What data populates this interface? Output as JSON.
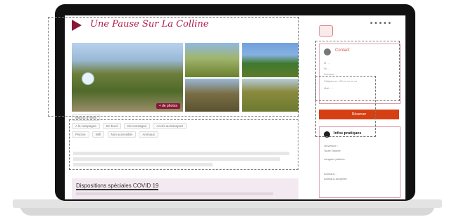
{
  "site": {
    "title": "Une Pause Sur La Colline",
    "photos_button": "+ de photos"
  },
  "sidebar": {
    "social_icons": [
      "twitter-icon",
      "facebook-icon",
      "instagram-icon",
      "email-icon",
      "phone-icon"
    ],
    "contact": {
      "title": "Contact",
      "lines": [
        "M. ...",
        "06 ...",
        "Adresse ...",
        "Téléphone : 06 xx xx xx xx",
        "Mail : ..."
      ]
    },
    "book_label": "Réserver",
    "info": {
      "title": "Infos pratiques",
      "lines": [
        "Ouverture :",
        "Toute l'année",
        "Langues parlées :",
        "Animaux :",
        "Animaux acceptés"
      ]
    }
  },
  "main": {
    "chips_row1": [
      "Maison d'hôtes"
    ],
    "chips_row2": [
      "A la campagne",
      "En bord",
      "De montagne",
      "Accès au transport"
    ],
    "chips_row3": [
      "Piscine",
      "Wifi",
      "Non accessible",
      "Animaux"
    ],
    "covid_title": "Dispositions spéciales COVID 19"
  },
  "colors": {
    "brand": "#b31e4b",
    "book_button": "#d63f12",
    "covid_bg": "#f3e9f0"
  }
}
